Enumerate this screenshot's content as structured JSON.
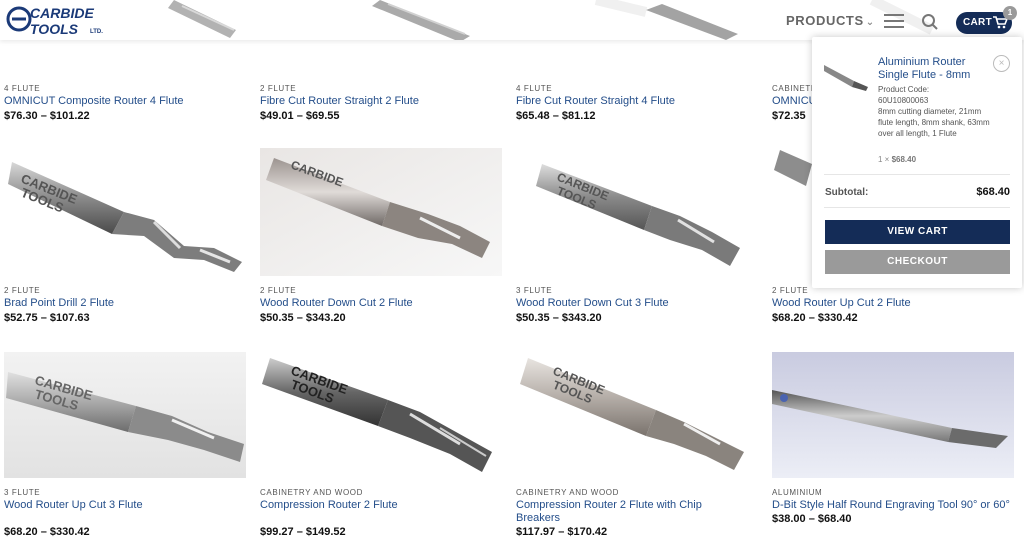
{
  "header": {
    "logo_line1": "CARBIDE",
    "logo_line2": "TOOLS",
    "logo_ltd": "LTD.",
    "products_label": "PRODUCTS",
    "cart_label": "CART",
    "cart_count": "1"
  },
  "top_row": [
    {
      "category": "4 FLUTE",
      "name": "OMNICUT Composite Router 4 Flute",
      "price": "$76.30 – $101.22"
    },
    {
      "category": "2 FLUTE",
      "name": "Fibre Cut Router Straight 2 Flute",
      "price": "$49.01 – $69.55"
    },
    {
      "category": "4 FLUTE",
      "name": "Fibre Cut Router Straight 4 Flute",
      "price": "$65.48 – $81.12"
    },
    {
      "category": "CABINETRY AND WOOD",
      "name": "OMNICUT",
      "price": "$72.35"
    }
  ],
  "middle_row": [
    {
      "category": "2 FLUTE",
      "name": "Brad Point Drill 2 Flute",
      "price": "$52.75 – $107.63"
    },
    {
      "category": "2 FLUTE",
      "name": "Wood Router Down Cut 2 Flute",
      "price": "$50.35 – $343.20"
    },
    {
      "category": "3 FLUTE",
      "name": "Wood Router Down Cut 3 Flute",
      "price": "$50.35 – $343.20"
    },
    {
      "category": "2 FLUTE",
      "name": "Wood Router Up Cut 2 Flute",
      "price": "$68.20 – $330.42"
    }
  ],
  "bottom_row": [
    {
      "category": "3 FLUTE",
      "name": "Wood Router Up Cut 3 Flute",
      "price": "$68.20 – $330.42"
    },
    {
      "category": "CABINETRY AND WOOD",
      "name": "Compression Router 2 Flute",
      "price": "$99.27 – $149.52"
    },
    {
      "category": "CABINETRY AND WOOD",
      "name": "Compression Router 2 Flute with Chip Breakers",
      "price": "$117.97 – $170.42"
    },
    {
      "category": "ALUMINIUM",
      "name": "D-Bit Style Half Round Engraving Tool 90° or 60°",
      "price": "$38.00 – $68.40"
    }
  ],
  "cart_dropdown": {
    "item_name": "Aluminium Router Single Flute - 8mm",
    "remove_symbol": "×",
    "code_label": "Product Code:",
    "code": "60U10800063",
    "description": "8mm cutting diameter, 21mm flute length, 8mm shank, 63mm over all length, 1 Flute",
    "qty_text": "1 ×",
    "qty_price": "$68.40",
    "subtotal_label": "Subtotal:",
    "subtotal_value": "$68.40",
    "view_cart_label": "VIEW CART",
    "checkout_label": "CHECKOUT"
  },
  "colors": {
    "brand_navy": "#142c57",
    "link_blue": "#244e8a",
    "checkout_grey": "#9a9a9a"
  },
  "icons": [
    "menu-icon",
    "search-icon",
    "cart-icon",
    "close-icon",
    "chevron-down-icon"
  ]
}
